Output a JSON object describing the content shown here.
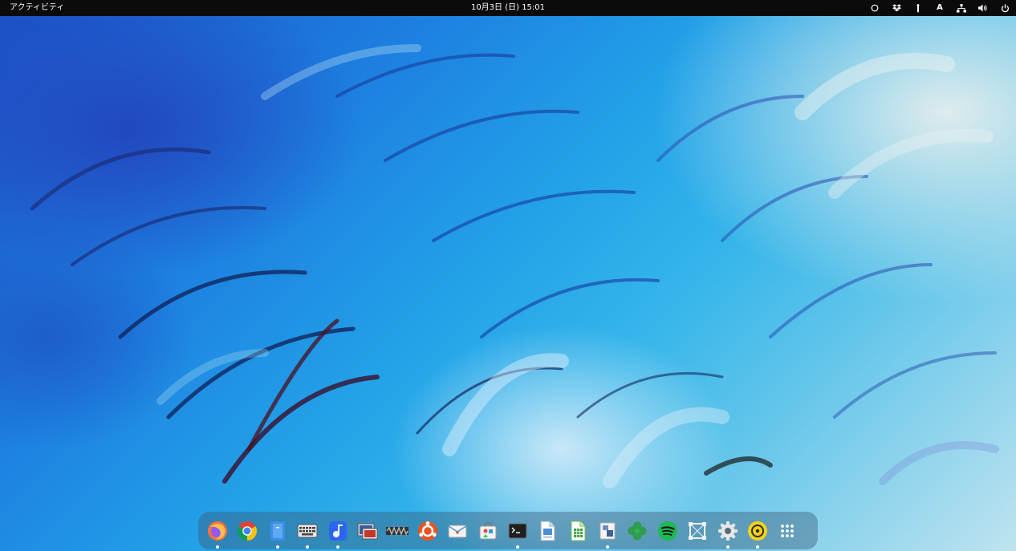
{
  "topbar": {
    "activities_label": "アクティビティ",
    "clock": "10月3日 (日)  15:01",
    "tray": [
      {
        "name": "circle-status-icon"
      },
      {
        "name": "dropbox-icon"
      },
      {
        "name": "switcher-icon"
      },
      {
        "name": "input-method-icon",
        "label": "A"
      },
      {
        "name": "network-icon"
      },
      {
        "name": "volume-icon"
      },
      {
        "name": "power-icon"
      }
    ]
  },
  "dock": {
    "items": [
      {
        "name": "firefox-icon",
        "running": true
      },
      {
        "name": "chrome-icon",
        "running": false
      },
      {
        "name": "files-icon",
        "running": true
      },
      {
        "name": "keyboard-app-icon",
        "running": true
      },
      {
        "name": "music-app-icon",
        "running": true
      },
      {
        "name": "photo-viewer-icon",
        "running": false
      },
      {
        "name": "sound-wave-app-icon",
        "running": false
      },
      {
        "name": "ubuntu-software-icon",
        "running": false
      },
      {
        "name": "mail-icon",
        "running": false
      },
      {
        "name": "software-store-icon",
        "running": false
      },
      {
        "name": "terminal-icon",
        "running": true
      },
      {
        "name": "document-viewer-icon",
        "running": false
      },
      {
        "name": "spreadsheet-icon",
        "running": false
      },
      {
        "name": "presentation-icon",
        "running": true
      },
      {
        "name": "clover-app-icon",
        "running": false
      },
      {
        "name": "spotify-icon",
        "running": false
      },
      {
        "name": "screenshot-tool-icon",
        "running": false
      },
      {
        "name": "settings-gear-icon",
        "running": true
      },
      {
        "name": "disc-burner-icon",
        "running": true
      },
      {
        "name": "show-applications-icon",
        "running": false
      }
    ]
  },
  "colors": {
    "topbar_bg": "#0b0b0b",
    "topbar_text": "#ffffff",
    "running_indicator": "#ffffff"
  }
}
